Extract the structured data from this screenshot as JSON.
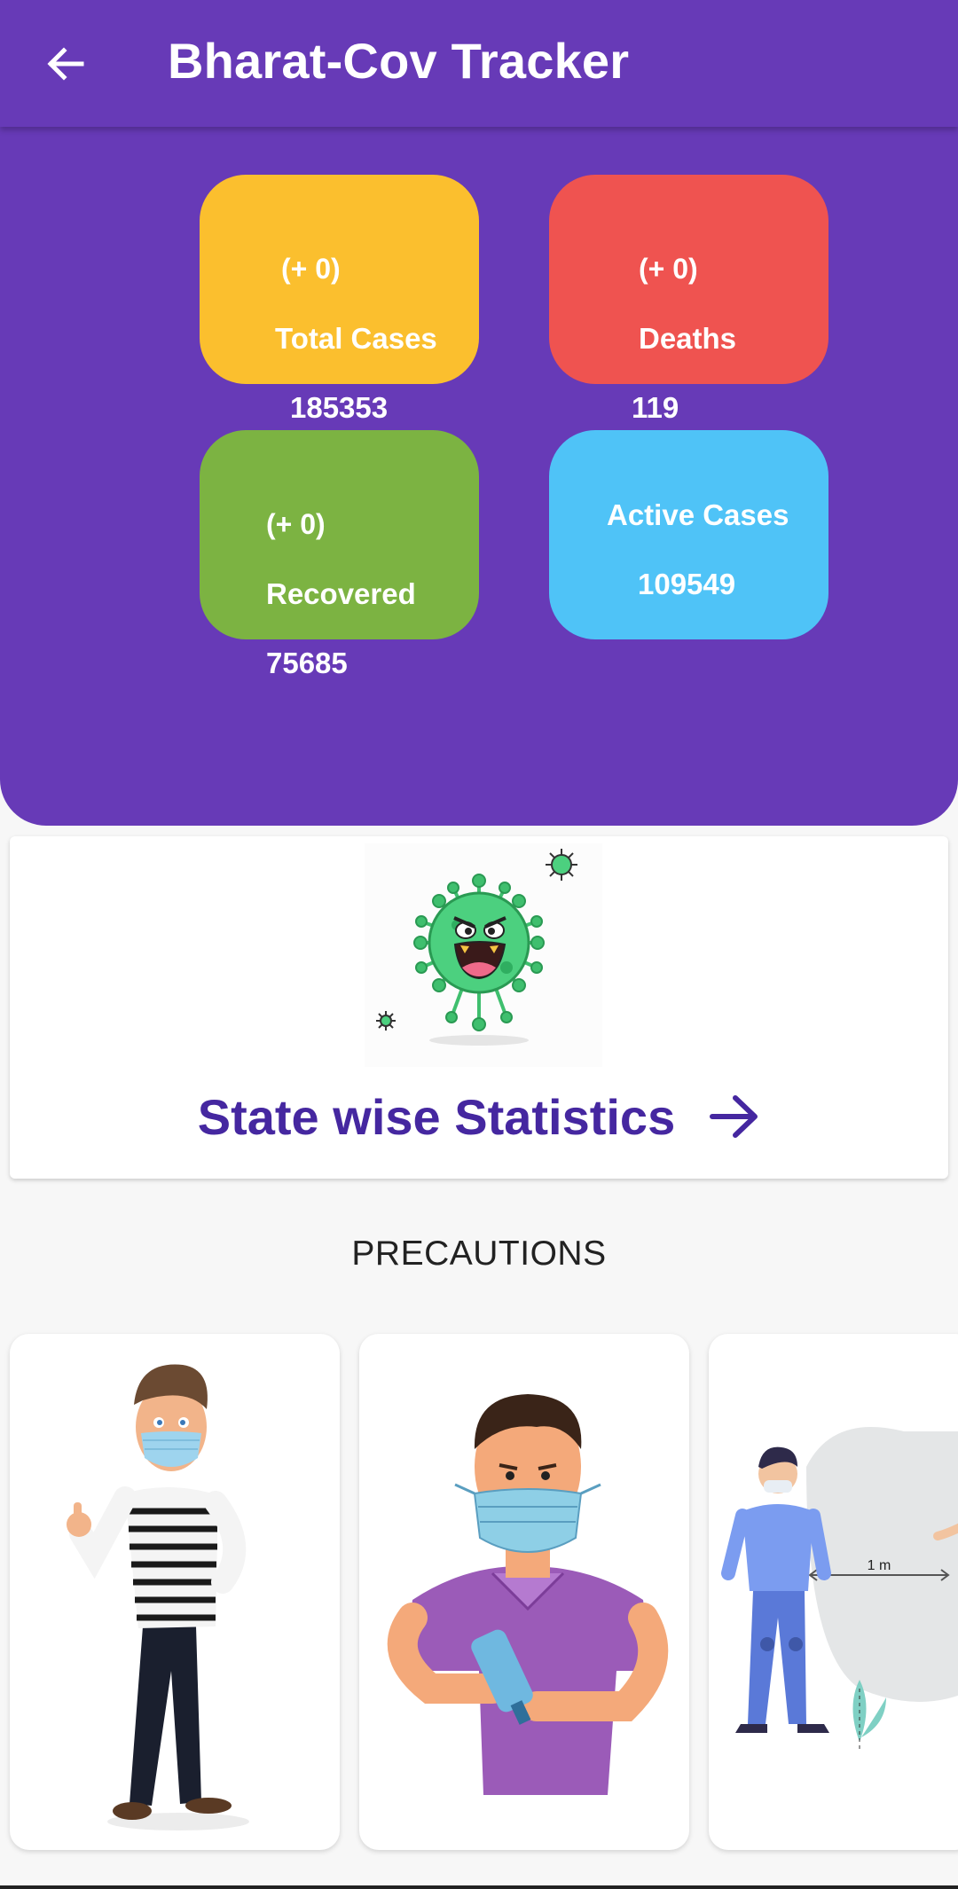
{
  "appbar": {
    "title": "Bharat-Cov Tracker",
    "back_icon": "arrow-left-icon",
    "background": "#673ab7"
  },
  "stats": {
    "total": {
      "delta": "(+ 0)",
      "label": "Total Cases",
      "value": "185353",
      "color": "#fbbf2e"
    },
    "deaths": {
      "delta": "(+ 0)",
      "label": "Deaths",
      "value": "119",
      "color": "#ef5350"
    },
    "recovered": {
      "delta": "(+ 0)",
      "label": "Recovered",
      "value": "75685",
      "color": "#7cb342"
    },
    "active": {
      "label": "Active Cases",
      "value": "109549",
      "color": "#4fc3f7"
    }
  },
  "state_stats": {
    "label": "State wise Statistics",
    "icon": "arrow-right-icon",
    "illustration": "virus-icon"
  },
  "precautions": {
    "heading": "PRECAUTIONS",
    "cards": [
      {
        "illustration": "masked-man-thumbs-up"
      },
      {
        "illustration": "man-using-sanitizer"
      },
      {
        "illustration": "social-distancing",
        "distance_label": "1 m"
      }
    ]
  }
}
